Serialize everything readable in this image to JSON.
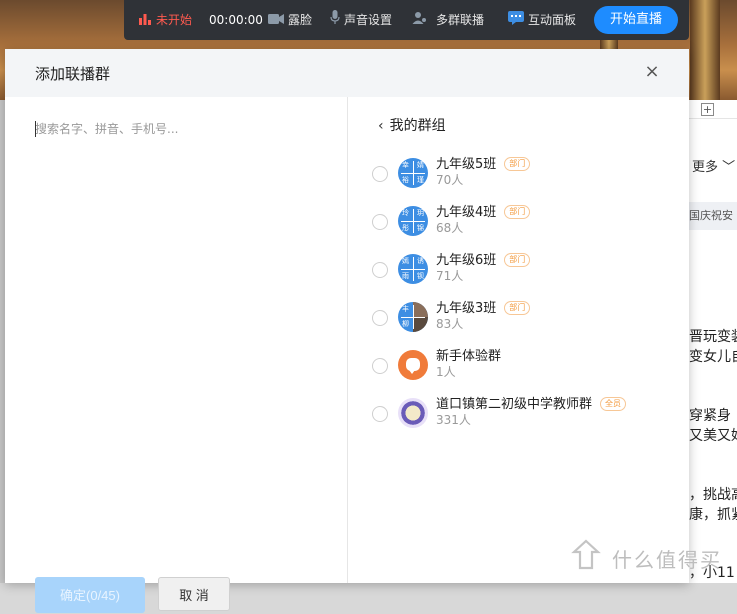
{
  "toolbar": {
    "status": "未开始",
    "time": "00:00:00",
    "beauty": "露脸",
    "sound": "声音设置",
    "multi": "多群联播",
    "interactive": "互动面板",
    "start": "开始直播"
  },
  "dialog": {
    "title": "添加联播群",
    "close": "×",
    "search_placeholder": "搜索名字、拼音、手机号...",
    "confirm": "确定(0/45)",
    "cancel": "取 消",
    "back_label": "我的群组",
    "groups": [
      {
        "name": "九年级5班",
        "count": "70人",
        "badge": "部门",
        "avatar_text": [
          "幸",
          "婧",
          "裕",
          "瑾"
        ]
      },
      {
        "name": "九年级4班",
        "count": "68人",
        "badge": "部门",
        "avatar_text": [
          "玲",
          "玥",
          "彤",
          "锦"
        ]
      },
      {
        "name": "九年级6班",
        "count": "71人",
        "badge": "部门",
        "avatar_text": [
          "嫣",
          "诱",
          "雨",
          "钡"
        ]
      },
      {
        "name": "九年级3班",
        "count": "83人",
        "badge": "部门",
        "avatar_text": [
          "丰",
          "",
          "柳",
          ""
        ]
      },
      {
        "name": "新手体验群",
        "count": "1人",
        "badge": ""
      },
      {
        "name": "道口镇第二初级中学教师群",
        "count": "331人",
        "badge": "全员"
      }
    ]
  },
  "right_panel": {
    "more": "更多 ﹀",
    "tag": "国庆祝安",
    "lines": [
      "晋玩变装",
      "变女儿自",
      "穿紧身",
      "又美又好",
      "，挑战高",
      "康，抓紧",
      "，小11"
    ]
  },
  "colors": {
    "accent": "#1e8cff",
    "status_red": "#ff5a4f",
    "badge_orange": "#f39a3d"
  },
  "watermark": "什么值得买"
}
